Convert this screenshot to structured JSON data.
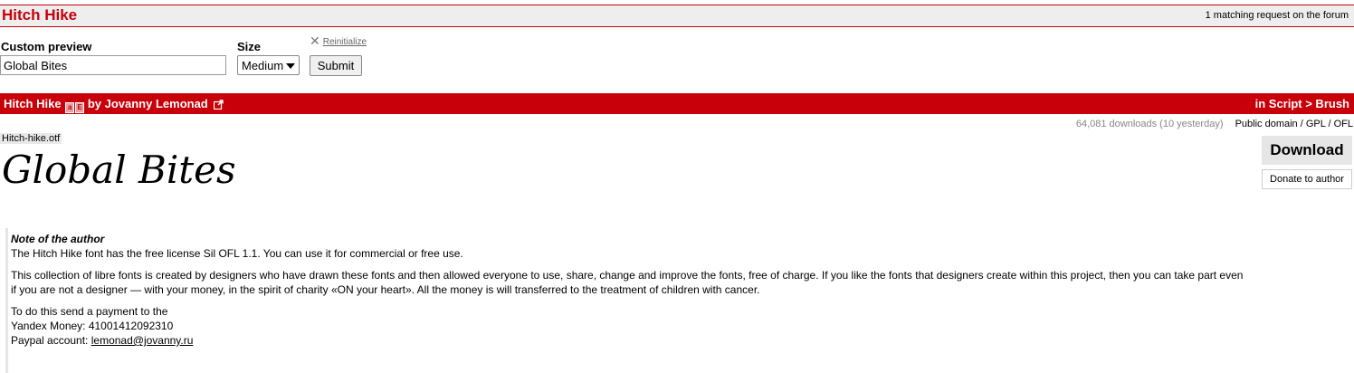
{
  "header": {
    "title": "Hitch Hike",
    "matching": "1 matching request on the forum"
  },
  "form": {
    "preview_label": "Custom preview",
    "preview_value": "Global Bites",
    "size_label": "Size",
    "size_value": "Medium",
    "reinit_label": "Reinitialize",
    "submit_label": "Submit"
  },
  "font_bar": {
    "name": "Hitch Hike",
    "by": "by Jovanny Lemonad",
    "badge_1": "a",
    "badge_2": "E",
    "category": "in Script > Brush"
  },
  "meta": {
    "downloads": "64,081 downloads (10 yesterday)",
    "license": "Public domain / GPL / OFL"
  },
  "preview": {
    "filename": "Hitch-hike.otf",
    "text": "Global Bites"
  },
  "actions": {
    "download": "Download",
    "donate": "Donate to author"
  },
  "note": {
    "title": "Note of the author",
    "line1": "The Hitch Hike font has the free license Sil OFL 1.1. You can use it for commercial or free use.",
    "para2_line1": "This collection of libre fonts is created by designers who have drawn these fonts and then allowed everyone to use, share, change and improve the fonts, free of charge. If you like the fonts that designers create within this project, then you can take part even",
    "para2_line2": "if you are not a designer — with your money, in the spirit of charity «ON your heart». All the money is will transferred to the treatment of children with cancer.",
    "pay_line1": "To do this send a payment to the",
    "pay_line2": "Yandex Money: 41001412092310",
    "pay_prefix": "Paypal account: ",
    "paypal_email": "lemonad@jovanny.ru"
  },
  "colors": {
    "brand_red": "#c8000a",
    "title_bg": "#eeeeee",
    "button_bg": "#e6e6e6"
  }
}
